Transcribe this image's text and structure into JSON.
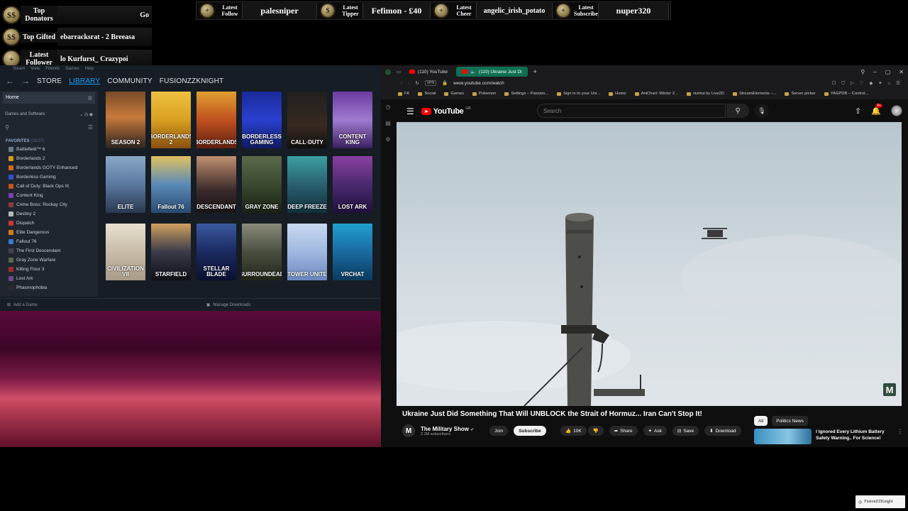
{
  "overlay": {
    "donor_rows": [
      {
        "label": "Top Donators",
        "value": "Go",
        "medal": "$$"
      },
      {
        "label": "Top Gifted",
        "value": "ebarracksrat - 2   Breeasa",
        "medal": "$$"
      },
      {
        "label": "Latest Follower",
        "value": "lo   Kurfurst_   Crazypoi",
        "medal": "+"
      }
    ],
    "ticker": [
      {
        "label": "Latest Follow",
        "value": "palesniper",
        "medal": "+"
      },
      {
        "label": "Latest Tipper",
        "value": "Fefimon - £40",
        "medal": "$"
      },
      {
        "label": "Latest Cheer",
        "value": "angelic_irish_potato",
        "medal": "+"
      },
      {
        "label": "Latest Subscriber",
        "value": "nuper320",
        "medal": "+"
      }
    ]
  },
  "steam": {
    "menu": [
      "Steam",
      "View",
      "Friends",
      "Games",
      "Help"
    ],
    "nav": {
      "store": "STORE",
      "library": "LIBRARY",
      "community": "COMMUNITY",
      "user": "FUSIONZZKNIGHT"
    },
    "sidebar": {
      "home": "Home",
      "filter": "Games and Software",
      "favorites_label": "FAVORITES",
      "favorites_count": "(38/37)",
      "games": [
        {
          "name": "Battlefield™ 6",
          "color": "#6b7a88"
        },
        {
          "name": "Borderlands 2",
          "color": "#d49a1f"
        },
        {
          "name": "Borderlands GOTY Enhanced",
          "color": "#d4641f"
        },
        {
          "name": "Borderless Gaming",
          "color": "#3050c8"
        },
        {
          "name": "Call of Duty: Black Ops III",
          "color": "#c4541a"
        },
        {
          "name": "Content King",
          "color": "#7a3fb0"
        },
        {
          "name": "Crime Boss: Rockay City",
          "color": "#8a3a3a"
        },
        {
          "name": "Destiny 2",
          "color": "#b7b7b7"
        },
        {
          "name": "Dispatch",
          "color": "#c83a3a"
        },
        {
          "name": "Elite Dangerous",
          "color": "#d07a20"
        },
        {
          "name": "Fallout 76",
          "color": "#3a7ac8"
        },
        {
          "name": "The First Descendant",
          "color": "#444"
        },
        {
          "name": "Gray Zone Warfare",
          "color": "#5a6a4a"
        },
        {
          "name": "Killing Floor 3",
          "color": "#a42a2a"
        },
        {
          "name": "Lost Ark",
          "color": "#6a4a8a"
        },
        {
          "name": "Phasmophobia",
          "color": "#2a2a2a"
        }
      ]
    },
    "grid": [
      {
        "label": "SEASON 2",
        "bg": "linear-gradient(180deg,#7a4a28,#c77a3c 45%,#2c2420)"
      },
      {
        "label": "BORDERLANDS 2",
        "bg": "linear-gradient(180deg,#f0c040,#d8a020 50%,#8a5010)"
      },
      {
        "label": "BORDERLANDS",
        "bg": "linear-gradient(180deg,#e0a030,#c05020 50%,#602010)"
      },
      {
        "label": "BORDERLESS GAMING",
        "bg": "linear-gradient(180deg,#1a2a9a,#2a40d0 50%,#101a60)"
      },
      {
        "label": "CALL·DUTY",
        "bg": "linear-gradient(180deg,#202020,#3a2a20 60%,#101010)"
      },
      {
        "label": "CONTENT KING",
        "bg": "linear-gradient(180deg,#6a3aa0,#a07ad0 50%,#3a2060)"
      },
      {
        "label": "ELITE",
        "bg": "linear-gradient(180deg,#8aa8c8,#5a78a0 50%,#2a3850)"
      },
      {
        "label": "Fallout 76",
        "bg": "linear-gradient(180deg,#e0c060,#5a8ab8 50%,#2a4a70)"
      },
      {
        "label": "DESCENDANT",
        "bg": "linear-gradient(180deg,#c09070,#3a2a2a 60%,#1a1414)"
      },
      {
        "label": "GRAY ZONE",
        "bg": "linear-gradient(180deg,#5a6a4a,#3a4a30 50%,#1a2014)"
      },
      {
        "label": "DEEP FREEZE",
        "bg": "linear-gradient(180deg,#3aa0a0,#2a6070 50%,#10303a)"
      },
      {
        "label": "LOST ARK",
        "bg": "linear-gradient(180deg,#8a40a0,#4a2a70 50%,#20103a)"
      },
      {
        "label": "CIVILIZATION VII",
        "bg": "linear-gradient(180deg,#e8e0d0,#c8bca8 50%,#a89c88)"
      },
      {
        "label": "STARFIELD",
        "bg": "linear-gradient(180deg,#d0a060,#3a3a4a 50%,#101018)"
      },
      {
        "label": "STELLAR BLADE",
        "bg": "linear-gradient(180deg,#3a5aa0,#1a2a60 50%,#0a1030)"
      },
      {
        "label": "SURROUNDEAD",
        "bg": "linear-gradient(180deg,#8a8a7a,#4a5040 50%,#202418)"
      },
      {
        "label": "TOWER UNITE",
        "bg": "linear-gradient(180deg,#c8d8f0,#a0b8e0 50%,#6a88c0)"
      },
      {
        "label": "VRCHAT",
        "bg": "linear-gradient(180deg,#20a0d0,#1a6aa0 50%,#0a3a60)"
      }
    ],
    "footer": {
      "add_game": "Add a Game",
      "manage_downloads": "Manage Downloads"
    }
  },
  "browser": {
    "tabs": [
      {
        "label": "(110) YouTube",
        "active": false
      },
      {
        "label": "(110) Ukraine Just Di",
        "active": true
      }
    ],
    "url": "www.youtube.com/watch",
    "vpn": "VPN",
    "bookmarks": [
      "FK",
      "Social",
      "Games",
      "Pokemon",
      "Settings – Passwo...",
      "Sign in to your Uni...",
      "Home",
      "AniChart: Winter 2...",
      "nizima by Live2D",
      "StreamElements –...",
      "Server picker",
      "YAGPDB – Control..."
    ]
  },
  "youtube": {
    "logo": "YouTube",
    "region": "GB",
    "search_placeholder": "Search",
    "notif_count": "9+",
    "watermark_letter": "M",
    "title": "Ukraine Just Did Something That Will UNBLOCK the Strait of Hormuz... Iran Can't Stop It!",
    "channel_name": "The Military Show",
    "channel_subs": "2.2M subscribers",
    "channel_initial": "M",
    "join": "Join",
    "subscribe": "Subscribe",
    "likes": "10K",
    "share": "Share",
    "ask": "Ask",
    "save": "Save",
    "download": "Download",
    "chips": [
      "All",
      "Politics News"
    ],
    "rec_title": "I Ignored Every Lithium Battery Safety Warning.. For Science!"
  },
  "streamer_tag": "FusionZZKnight"
}
